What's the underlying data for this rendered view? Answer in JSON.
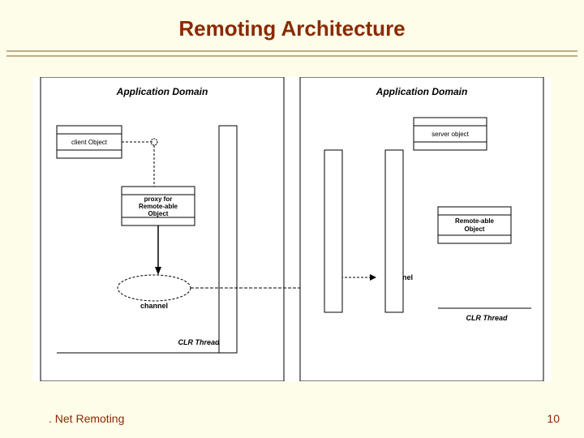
{
  "slide": {
    "title": "Remoting Architecture",
    "footer_left": ". Net Remoting",
    "footer_right": "10"
  },
  "diagram": {
    "left": {
      "title": "Application Domain",
      "client": "client Object",
      "proxy": "proxy for\nRemote-able\nObject",
      "channel": "channel",
      "thread": "CLR Thread"
    },
    "right": {
      "title": "Application Domain",
      "server": "server object",
      "remoteable": "Remote-able\nObject",
      "channel": "channel",
      "thread": "CLR Thread"
    }
  }
}
